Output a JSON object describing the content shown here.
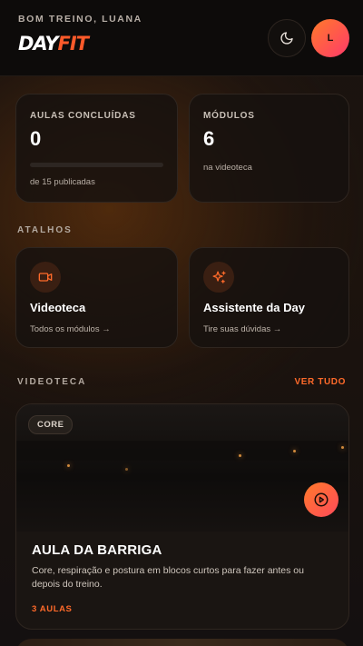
{
  "header": {
    "greeting": "BOM TREINO, LUANA",
    "logo_day": "DAY",
    "logo_fit": "FIT",
    "avatar_initial": "L"
  },
  "stats": [
    {
      "label": "AULAS CONCLUÍDAS",
      "value": "0",
      "sub": "de 15 publicadas",
      "progress": 0
    },
    {
      "label": "MÓDULOS",
      "value": "6",
      "sub": "na videoteca"
    }
  ],
  "shortcuts": {
    "title": "ATALHOS",
    "items": [
      {
        "icon": "video-camera-icon",
        "title": "Videoteca",
        "sub": "Todos os módulos →"
      },
      {
        "icon": "sparkles-icon",
        "title": "Assistente da Day",
        "sub": "Tire suas dúvidas →"
      }
    ]
  },
  "library": {
    "title": "VIDEOTECA",
    "see_all": "VER TUDO",
    "video": {
      "badge": "CORE",
      "title": "AULA DA BARRIGA",
      "description": "Core, respiração e postura em blocos curtos para fazer antes ou depois do treino.",
      "count": "3 AULAS"
    }
  },
  "colors": {
    "accent": "#ff6a2a",
    "background": "#141010",
    "card": "#16110f"
  }
}
